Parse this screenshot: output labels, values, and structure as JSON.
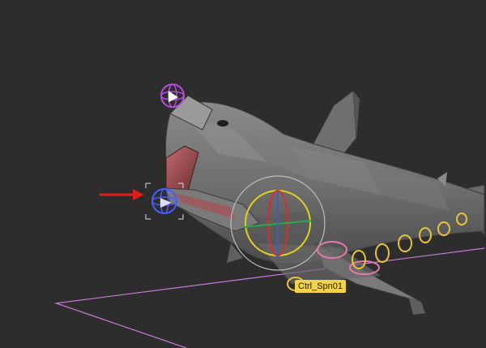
{
  "viewport": {
    "background": "#2d2d2d",
    "grid_color": "#c77ad8",
    "shark_color": "#7b7b7b",
    "mouth_color": "#b55a5f"
  },
  "controls": {
    "spine_label": "Ctrl_Spn01",
    "spine_label_color": "#f2d34a"
  },
  "annotation": {
    "arrow_color": "#e21c1c",
    "points_to": "jaw-controller"
  },
  "icons": [
    "head-controller-icon",
    "jaw-controller-icon",
    "spine-controller-icon",
    "tail-controller-icon",
    "annotation-arrow-icon"
  ]
}
